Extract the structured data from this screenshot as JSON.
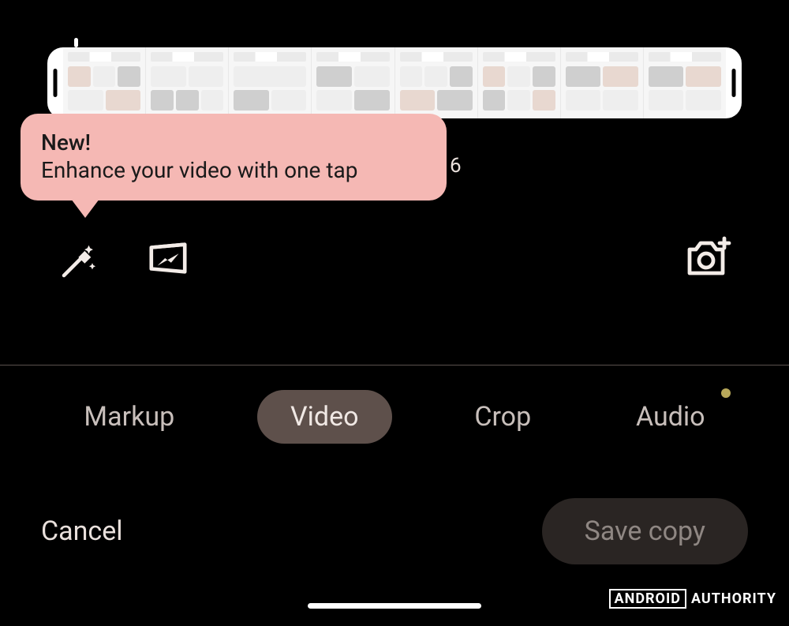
{
  "tooltip": {
    "title": "New!",
    "body": "Enhance your video with one tap"
  },
  "behind_tooltip_text": "6",
  "icons": {
    "magic_wand": "magic-wand-icon",
    "frame": "frame-icon",
    "export": "frame-export-icon"
  },
  "tabs": {
    "items": [
      {
        "label": "Markup",
        "active": false,
        "has_dot": false
      },
      {
        "label": "Video",
        "active": true,
        "has_dot": false
      },
      {
        "label": "Crop",
        "active": false,
        "has_dot": false
      },
      {
        "label": "Audio",
        "active": false,
        "has_dot": true
      }
    ]
  },
  "actions": {
    "cancel_label": "Cancel",
    "save_label": "Save copy"
  },
  "watermark": {
    "boxed": "ANDROID",
    "plain": "AUTHORITY"
  }
}
